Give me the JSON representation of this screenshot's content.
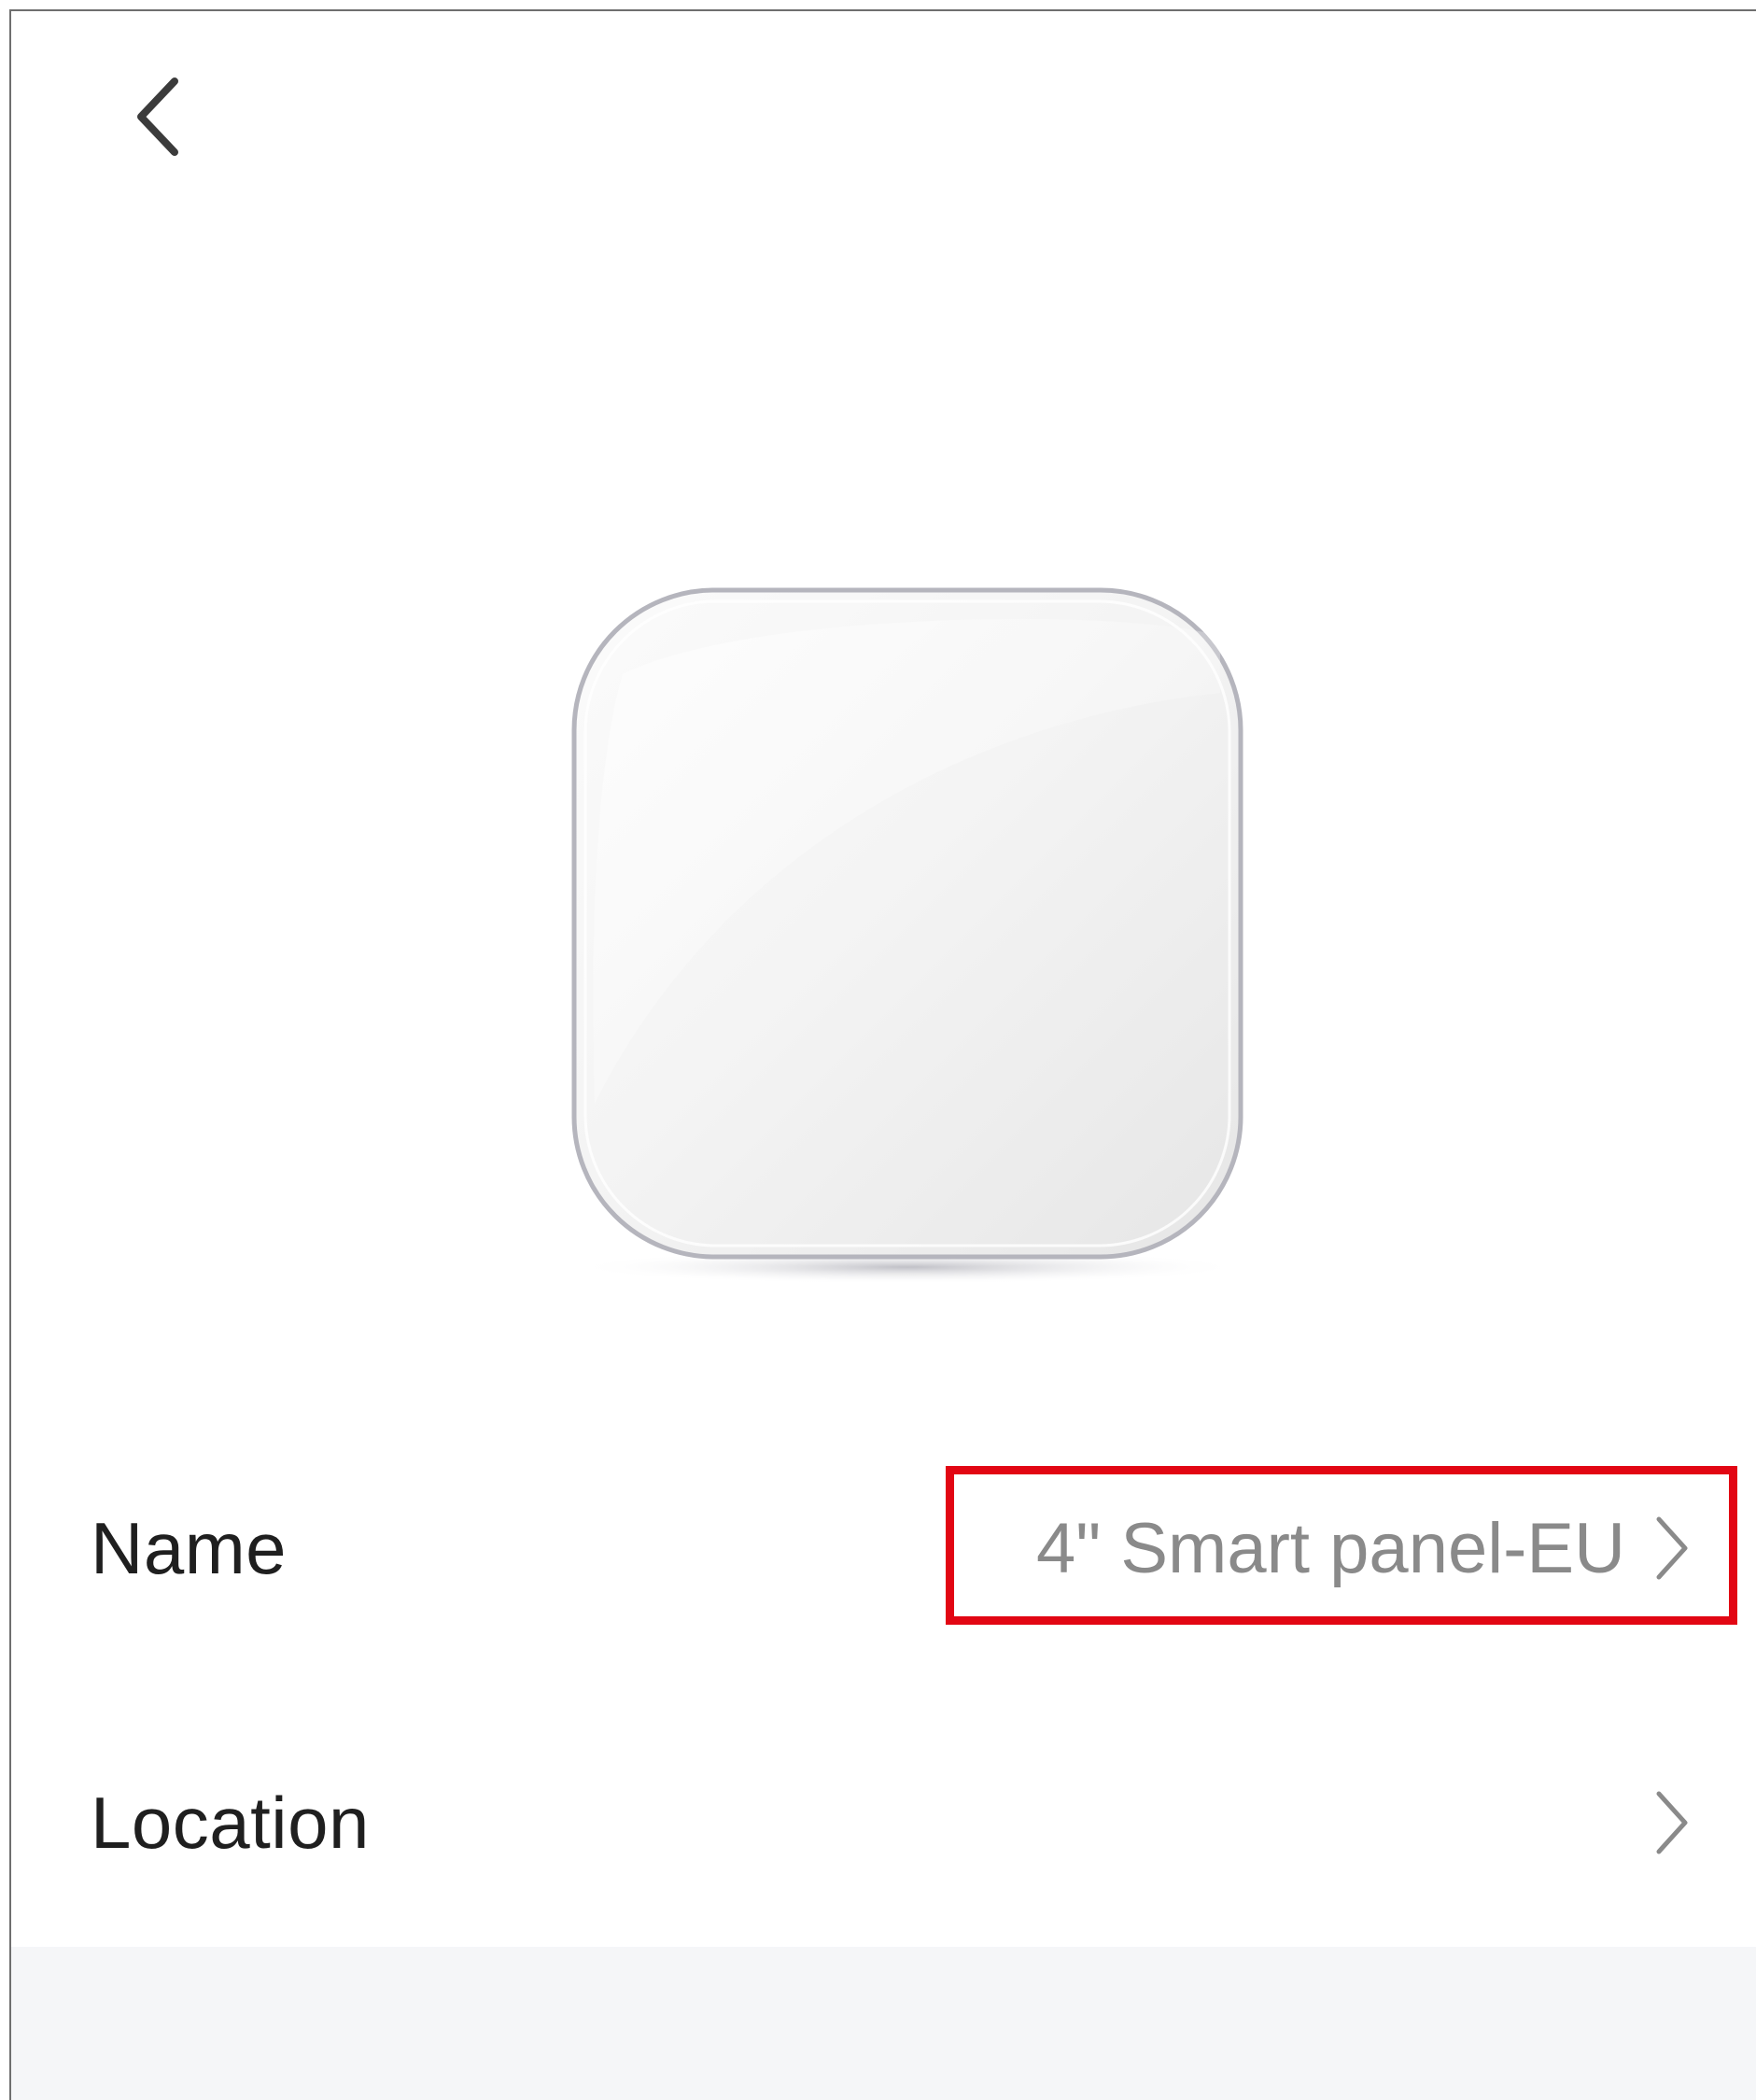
{
  "header": {
    "back_icon": "chevron-left-icon"
  },
  "device": {
    "image_icon": "smart-panel-device-image"
  },
  "settings": {
    "name": {
      "label": "Name",
      "value": "4\" Smart panel-EU",
      "icon": "chevron-right-icon"
    },
    "location": {
      "label": "Location",
      "value": "",
      "icon": "chevron-right-icon"
    }
  },
  "colors": {
    "highlight_border": "#e20613",
    "label_text": "#1f1f1f",
    "value_text": "#8a8a8a",
    "footer_bg": "#f5f6f8"
  }
}
